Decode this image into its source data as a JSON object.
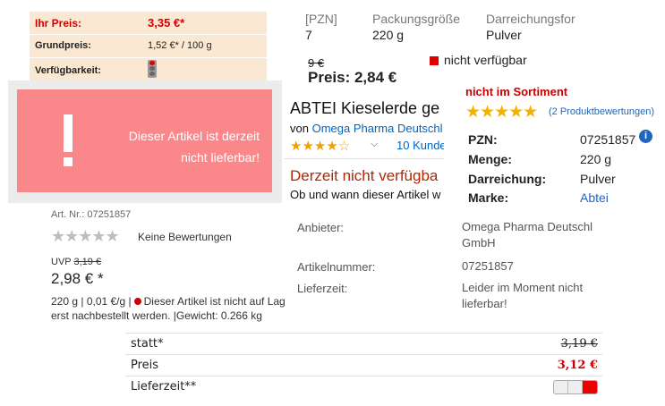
{
  "panel1": {
    "price_label": "Ihr Preis:",
    "price_value": "3,35 €*",
    "grundpreis_label": "Grundpreis:",
    "grundpreis_value": "1,52 €* / 100 g",
    "availability_label": "Verfügbarkeit:",
    "availability_icon": "traffic-light-red-icon"
  },
  "panel2": {
    "col_pzn": "[PZN]",
    "col_pzn_value": "7",
    "col_size": "Packungsgröße",
    "col_size_value": "220 g",
    "col_form": "Darreichungsfor",
    "col_form_value": "Pulver",
    "old_price": "9 €",
    "price": "Preis: 2,84 €",
    "availability": "nicht verfügbar",
    "status_color": "#e00000"
  },
  "panel3": {
    "message_line1": "Dieser Artikel ist derzeit",
    "message_line2": "nicht lieferbar!",
    "bg_color": "#fa878a"
  },
  "panel4": {
    "title": "ABTEI Kieselerde ge",
    "by_prefix": "von",
    "brand_link": "Omega Pharma Deutschl",
    "stars": "★★★★☆",
    "rating_count": "10 Kunde",
    "unavailable": "Derzeit nicht verfügba",
    "question": "Ob und wann dieser Artikel w"
  },
  "panel5": {
    "status": "nicht im Sortiment",
    "stars": "★★★★★",
    "reviews": "(2 Produktbewertungen)",
    "rows": [
      {
        "key": "PZN:",
        "value": "07251857"
      },
      {
        "key": "Menge:",
        "value": "220 g"
      },
      {
        "key": "Darreichung:",
        "value": "Pulver"
      },
      {
        "key": "Marke:",
        "value": "Abtei"
      }
    ]
  },
  "panel6": {
    "art_nr": "Art. Nr.: 07251857",
    "stars": "★★★★★",
    "no_reviews": "Keine Bewertungen",
    "uvp_label": "UVP",
    "uvp_value": "3,19 €",
    "price": "2,98 € *",
    "line1_a": "220 g | 0,01 €/g |",
    "line1_b": "Dieser Artikel ist nicht auf Lag",
    "line2": "erst nachbestellt werden. |Gewicht: 0.266 kg"
  },
  "panel7": {
    "rows": [
      {
        "key": "Anbieter:",
        "value": "Omega Pharma Deutschl GmbH"
      },
      {
        "key": "Artikelnummer:",
        "value": "07251857"
      },
      {
        "key": "Lieferzeit:",
        "value": "Leider im Moment nicht lieferbar!"
      }
    ]
  },
  "panel8": {
    "statt_label": "statt*",
    "statt_value": "3,19 €",
    "preis_label": "Preis",
    "preis_value": "3,12 €",
    "lieferzeit_label": "Lieferzeit**",
    "delivery_indicator": "red"
  }
}
